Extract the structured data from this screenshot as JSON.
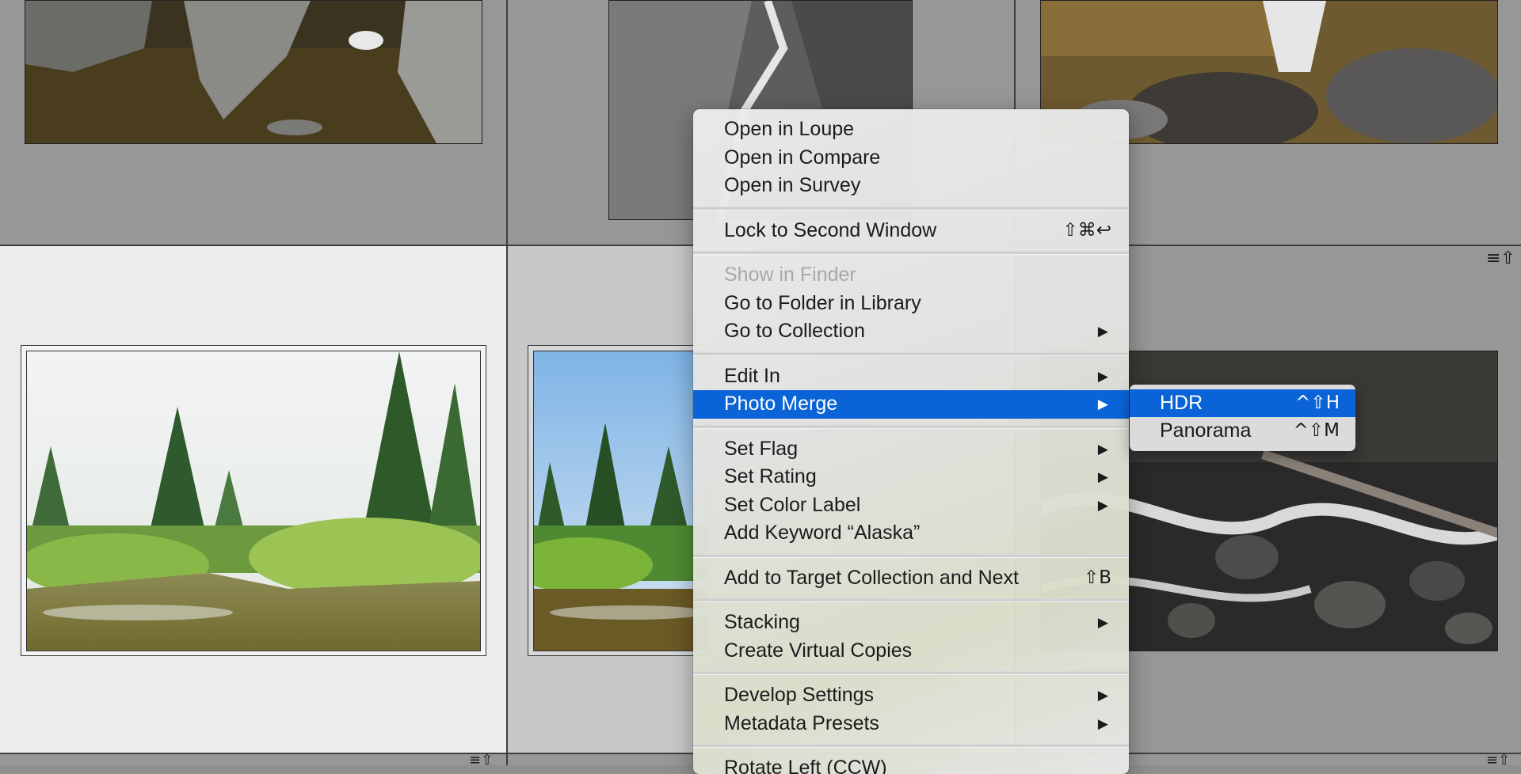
{
  "grid": {
    "badges": {
      "stack_icon": "≡⇧"
    }
  },
  "context_menu": {
    "groups": [
      [
        {
          "label": "Open in Loupe"
        },
        {
          "label": "Open in Compare"
        },
        {
          "label": "Open in Survey"
        }
      ],
      [
        {
          "label": "Lock to Second Window",
          "shortcut": "⇧⌘↩"
        }
      ],
      [
        {
          "label": "Show in Finder",
          "disabled": true
        },
        {
          "label": "Go to Folder in Library"
        },
        {
          "label": "Go to Collection",
          "submenu": true
        }
      ],
      [
        {
          "label": "Edit In",
          "submenu": true
        },
        {
          "label": "Photo Merge",
          "submenu": true,
          "active": true
        }
      ],
      [
        {
          "label": "Set Flag",
          "submenu": true
        },
        {
          "label": "Set Rating",
          "submenu": true
        },
        {
          "label": "Set Color Label",
          "submenu": true
        },
        {
          "label": "Add Keyword “Alaska”"
        }
      ],
      [
        {
          "label": "Add to Target Collection and Next",
          "shortcut": "⇧B"
        }
      ],
      [
        {
          "label": "Stacking",
          "submenu": true
        },
        {
          "label": "Create Virtual Copies"
        }
      ],
      [
        {
          "label": "Develop Settings",
          "submenu": true
        },
        {
          "label": "Metadata Presets",
          "submenu": true
        }
      ],
      [
        {
          "label": "Rotate Left (CCW)"
        }
      ]
    ],
    "arrow_glyph": "▶"
  },
  "photo_merge_submenu": {
    "items": [
      {
        "label": "HDR",
        "shortcut": "^⇧H",
        "active": true
      },
      {
        "label": "Panorama",
        "shortcut": "^⇧M"
      }
    ]
  },
  "colors": {
    "highlight": "#0b64d7",
    "cell_dim": "#979797",
    "cell_selected": "#ececec"
  }
}
